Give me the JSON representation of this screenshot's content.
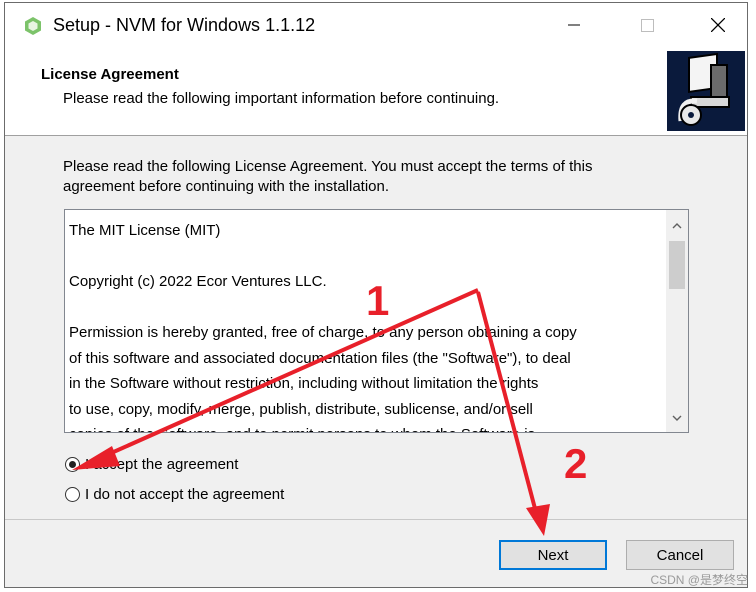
{
  "window": {
    "title": "Setup - NVM for Windows 1.1.12"
  },
  "header": {
    "title": "License Agreement",
    "subtitle": "Please read the following important information before continuing."
  },
  "intro": {
    "line1": "Please read the following License Agreement. You must accept the terms of this",
    "line2": "agreement before continuing with the installation."
  },
  "license": {
    "lines": [
      "The MIT License (MIT)",
      "",
      "Copyright (c) 2022 Ecor Ventures LLC.",
      "",
      "Permission is hereby granted, free of charge, to any person obtaining a copy",
      "of this software and associated documentation files (the \"Software\"), to deal",
      "in the Software without restriction, including without limitation the rights",
      "to use, copy, modify, merge, publish, distribute, sublicense, and/or sell",
      "copies of the Software, and to permit persons to whom the Software is"
    ]
  },
  "options": {
    "accept": {
      "label": "I accept the agreement",
      "selected": true
    },
    "decline": {
      "label": "I do not accept the agreement",
      "selected": false
    }
  },
  "buttons": {
    "next": "Next",
    "cancel": "Cancel"
  },
  "annotations": {
    "marker1": "1",
    "marker2": "2",
    "color": "#e8202a"
  },
  "watermark": "CSDN @是梦终空"
}
